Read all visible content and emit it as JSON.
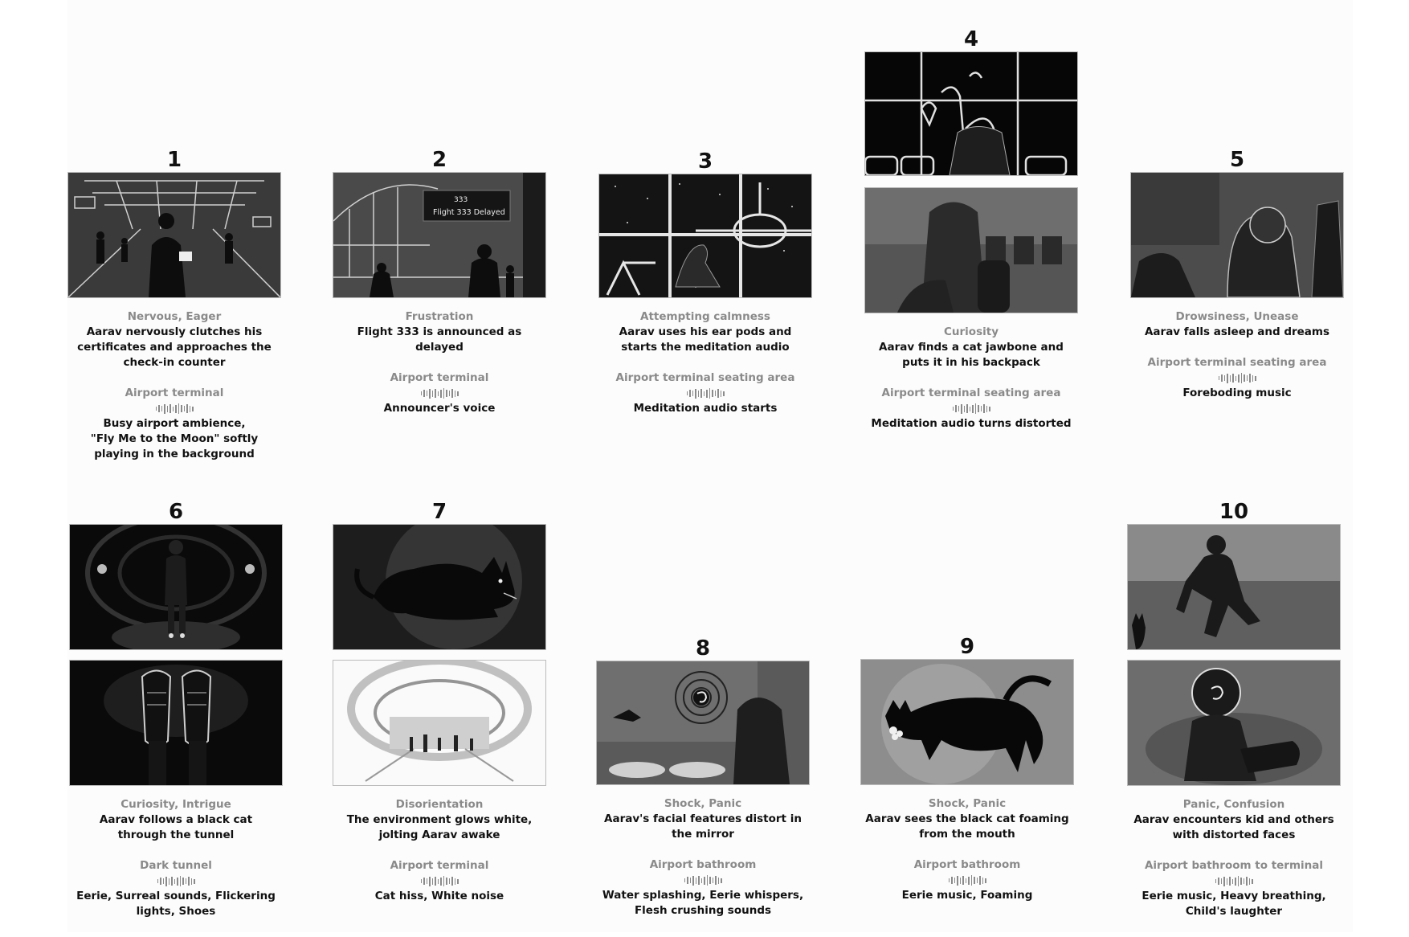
{
  "panels": [
    {
      "number": "1",
      "emotion": "Nervous, Eager",
      "action": "Aarav nervously clutches his certificates and approaches the check-in counter",
      "location": "Airport terminal",
      "sound": "Busy airport ambience,\n\"Fly Me to the Moon\" softly playing in the background",
      "icons": [
        "airport-crowd-image"
      ]
    },
    {
      "number": "2",
      "emotion": "Frustration",
      "action": "Flight 333 is announced as delayed",
      "location": "Airport terminal",
      "sound": "Announcer's voice",
      "icons": [
        "delay-board-image"
      ],
      "board_text": "Flight 333 Delayed",
      "board_code": "333"
    },
    {
      "number": "3",
      "emotion": "Attempting calmness",
      "action": "Aarav uses his ear pods and starts the meditation audio",
      "location": "Airport terminal seating area",
      "sound": "Meditation audio starts",
      "icons": [
        "window-plane-image"
      ]
    },
    {
      "number": "4",
      "emotion": "Curiosity",
      "action": "Aarav finds a cat jawbone and puts it in his backpack",
      "location": "Airport terminal seating area",
      "sound": "Meditation audio turns distorted",
      "icons": [
        "pov-feet-image",
        "seated-backpack-image"
      ]
    },
    {
      "number": "5",
      "emotion": "Drowsiness, Unease",
      "action": "Aarav falls asleep and dreams",
      "location": "Airport terminal seating area",
      "sound": "Foreboding music",
      "icons": [
        "sleeping-image"
      ]
    },
    {
      "number": "6",
      "emotion": "Curiosity, Intrigue",
      "action": "Aarav follows a black cat through the tunnel",
      "location": "Dark tunnel",
      "sound": "Eerie, Surreal sounds, Flickering lights, Shoes",
      "icons": [
        "tunnel-figure-image",
        "shoes-image"
      ]
    },
    {
      "number": "7",
      "emotion": "Disorientation",
      "action": "The environment glows white, jolting Aarav awake",
      "location": "Airport terminal",
      "sound": "Cat hiss, White noise",
      "icons": [
        "hissing-cat-image",
        "white-terminal-image"
      ]
    },
    {
      "number": "8",
      "emotion": "Shock, Panic",
      "action": "Aarav's facial features distort in the mirror",
      "location": "Airport bathroom",
      "sound": "Water splashing, Eerie whispers, Flesh crushing sounds",
      "icons": [
        "mirror-swirl-image"
      ]
    },
    {
      "number": "9",
      "emotion": "Shock, Panic",
      "action": "Aarav sees the black cat foaming from the mouth",
      "location": "Airport bathroom",
      "sound": "Eerie music, Foaming",
      "icons": [
        "foaming-cat-image"
      ]
    },
    {
      "number": "10",
      "emotion": "Panic, Confusion",
      "action": "Aarav encounters kid and others with distorted faces",
      "location": "Airport bathroom to terminal",
      "sound": "Eerie music, Heavy breathing, Child's laughter",
      "icons": [
        "running-figure-image",
        "distorted-kid-image"
      ]
    }
  ],
  "colors": {
    "background": "#fcfcfc",
    "label_gray": "#8a8a8a",
    "text_dark": "#111111"
  }
}
